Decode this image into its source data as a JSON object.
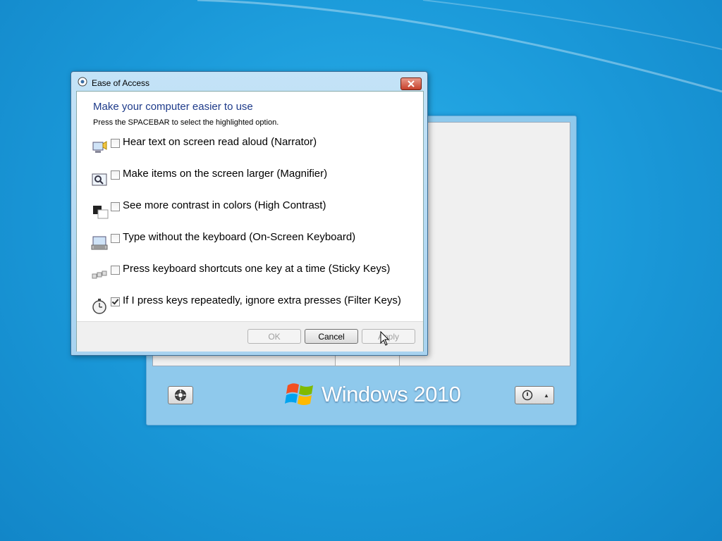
{
  "desktop": {
    "brand": "Windows 2010"
  },
  "dialog": {
    "title": "Ease of Access",
    "heading": "Make your computer easier to use",
    "hint": "Press the SPACEBAR to select the highlighted option.",
    "options": [
      {
        "label": "Hear text on screen read aloud (Narrator)",
        "checked": false,
        "icon": "narrator-icon"
      },
      {
        "label": "Make items on the screen larger (Magnifier)",
        "checked": false,
        "icon": "magnifier-icon"
      },
      {
        "label": "See more contrast in colors (High Contrast)",
        "checked": false,
        "icon": "high-contrast-icon"
      },
      {
        "label": "Type without the keyboard (On-Screen Keyboard)",
        "checked": false,
        "icon": "on-screen-keyboard-icon"
      },
      {
        "label": "Press keyboard shortcuts one key at a time (Sticky Keys)",
        "checked": false,
        "icon": "sticky-keys-icon"
      },
      {
        "label": "If I press keys repeatedly, ignore extra presses (Filter Keys)",
        "checked": true,
        "icon": "filter-keys-icon"
      }
    ],
    "buttons": {
      "ok": "OK",
      "cancel": "Cancel",
      "apply": "Apply"
    }
  }
}
